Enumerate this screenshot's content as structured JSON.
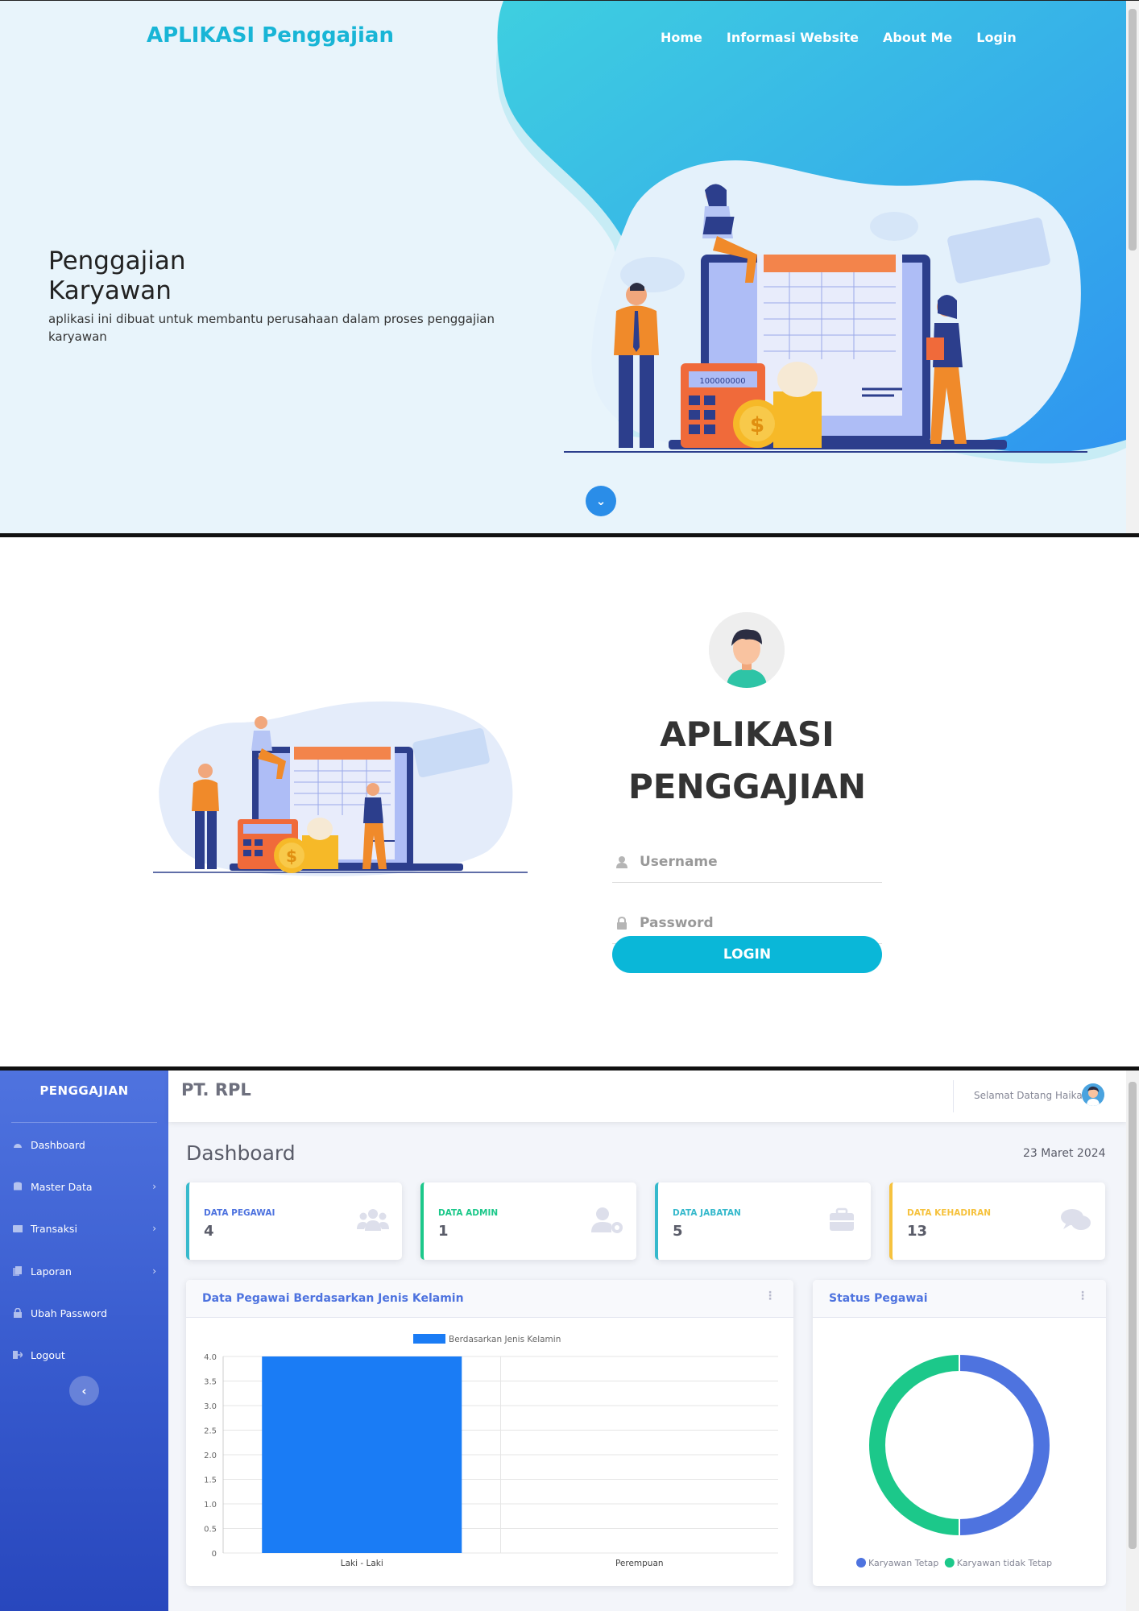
{
  "landing": {
    "brand": "APLIKASI Penggajian",
    "nav": [
      "Home",
      "Informasi Website",
      "About Me",
      "Login"
    ],
    "hero_title": "Penggajian Karyawan",
    "hero_desc": "aplikasi ini dibuat untuk membantu perusahaan dalam proses penggajian karyawan",
    "calculator_display": "100000000",
    "accent_color": "#18b5d6"
  },
  "login": {
    "title_line1": "APLIKASI",
    "title_line2": "PENGGAJIAN",
    "username_placeholder": "Username",
    "password_placeholder": "Password",
    "login_button": "LOGIN",
    "button_color": "#0ab7d8"
  },
  "dashboard": {
    "sidebar": {
      "brand": "PENGGAJIAN",
      "items": [
        {
          "label": "Dashboard",
          "icon": "tachometer-icon"
        },
        {
          "label": "Master Data",
          "icon": "database-icon"
        },
        {
          "label": "Transaksi",
          "icon": "keyboard-icon"
        },
        {
          "label": "Laporan",
          "icon": "copy-icon"
        },
        {
          "label": "Ubah Password",
          "icon": "lock-icon"
        },
        {
          "label": "Logout",
          "icon": "sign-out-icon"
        }
      ]
    },
    "company": "PT. RPL",
    "welcome": "Selamat Datang Haikal",
    "page_title": "Dashboard",
    "date": "23 Maret 2024",
    "cards": [
      {
        "label": "DATA PEGAWAI",
        "value": "4",
        "color": "#36b9cc",
        "icon": "users-icon"
      },
      {
        "label": "DATA ADMIN",
        "value": "1",
        "color": "#1cc88a",
        "icon": "user-cog-icon"
      },
      {
        "label": "DATA JABATAN",
        "value": "5",
        "color": "#36b9cc",
        "icon": "briefcase-icon"
      },
      {
        "label": "DATA KEHADIRAN",
        "value": "13",
        "color": "#f6c23e",
        "icon": "comments-icon"
      }
    ],
    "bar_panel_title": "Data Pegawai Berdasarkan Jenis Kelamin",
    "pie_panel_title": "Status Pegawai"
  },
  "chart_data": [
    {
      "type": "bar",
      "title": "",
      "categories": [
        "Laki - Laki",
        "Perempuan"
      ],
      "series": [
        {
          "name": "Berdasarkan Jenis Kelamin",
          "values": [
            4,
            0
          ],
          "color": "#1a7cf5"
        }
      ],
      "yticks": [
        "0",
        "0.5",
        "1.0",
        "1.5",
        "2.0",
        "2.5",
        "3.0",
        "3.5",
        "4.0"
      ],
      "ylim": [
        0,
        4
      ],
      "legend": "top",
      "grid": true
    },
    {
      "type": "pie",
      "title": "",
      "labels": [
        "Karyawan Tetap",
        "Karyawan tidak Tetap"
      ],
      "values": [
        2,
        2
      ],
      "colors": [
        "#4e73df",
        "#1cc88a"
      ],
      "legend": "bottom"
    }
  ]
}
